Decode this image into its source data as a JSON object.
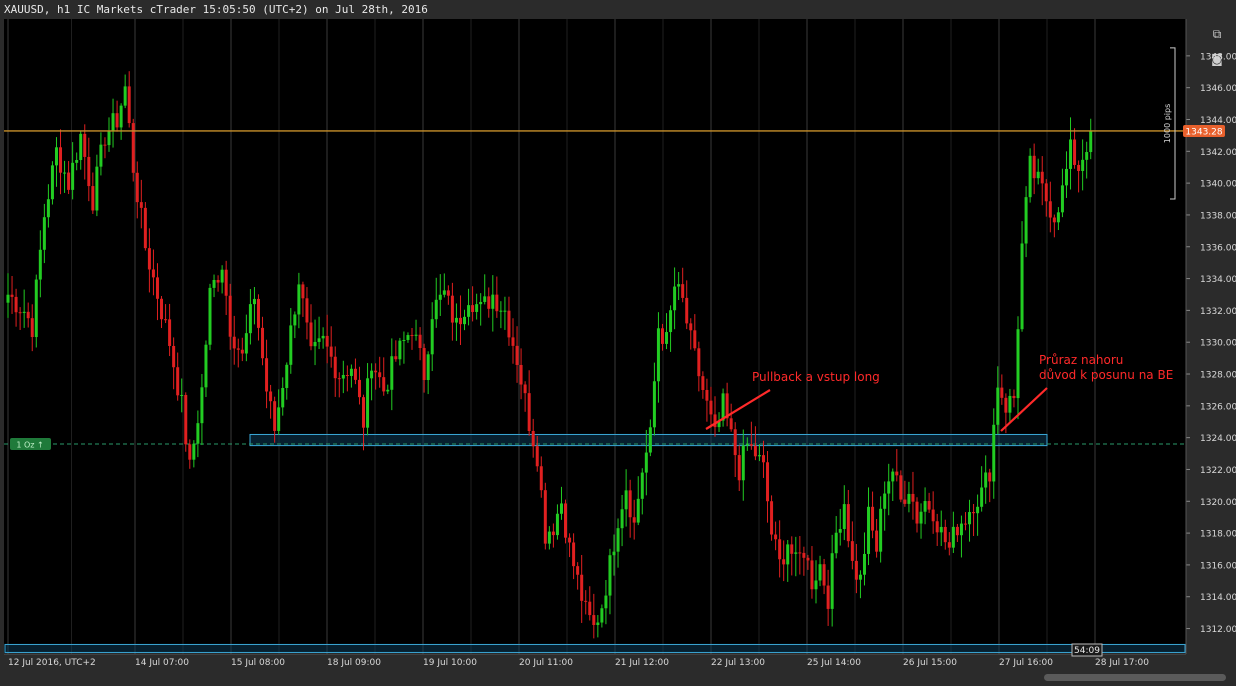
{
  "window": {
    "title": "XAUUSD, h1 IC Markets cTrader 15:05:50 (UTC+2) on Jul 28th, 2016",
    "toolbar_icons": [
      "popout-icon",
      "camera-icon"
    ]
  },
  "colors": {
    "background": "#000000",
    "frame": "#2b2b2b",
    "bull_candle": "#22cc22",
    "bear_candle": "#e02020",
    "price_line": "#c8902a",
    "price_tag": "#e8602c",
    "zone_fill": "#0d3b55",
    "zone_border": "#3aa8d8",
    "grid": "#2a2a2a",
    "annotation": "#ff2a2a",
    "position_tag": "#1f7a3a"
  },
  "chart_data": {
    "type": "candlestick",
    "symbol": "XAUUSD",
    "timeframe": "h1",
    "ylim": [
      1310.4,
      1349.5
    ],
    "y_ticks": [
      "1348.00",
      "1346.00",
      "1344.00",
      "1342.00",
      "1340.00",
      "1338.00",
      "1336.00",
      "1334.00",
      "1332.00",
      "1330.00",
      "1328.00",
      "1326.00",
      "1324.00",
      "1322.00",
      "1320.00",
      "1318.00",
      "1316.00",
      "1314.00",
      "1312.00"
    ],
    "x_ticks": [
      "12 Jul 2016, UTC+2",
      "14 Jul 07:00",
      "15 Jul 08:00",
      "18 Jul 09:00",
      "19 Jul 10:00",
      "20 Jul 11:00",
      "21 Jul 12:00",
      "22 Jul 13:00",
      "25 Jul 14:00",
      "26 Jul 15:00",
      "27 Jul 16:00",
      "28 Jul 17:00"
    ],
    "current_price": "1343.28",
    "current_price_value": 1343.28,
    "position_label": "1 Oz ↑",
    "position_price": 1323.6,
    "measure_label": "1000 pips",
    "countdown": "54:09",
    "zones": [
      {
        "from": 1323.5,
        "to": 1324.2
      },
      {
        "from": 1310.5,
        "to": 1311.0
      }
    ],
    "annotations": [
      "Pullback a vstup long",
      "Průraz nahoru",
      "důvod k posunu na BE"
    ],
    "key_prices": [
      {
        "i": 0,
        "p": 1333.0
      },
      {
        "i": 4,
        "p": 1332.0
      },
      {
        "i": 6,
        "p": 1331.0
      },
      {
        "i": 9,
        "p": 1338.0
      },
      {
        "i": 12,
        "p": 1342.0
      },
      {
        "i": 15,
        "p": 1340.0
      },
      {
        "i": 18,
        "p": 1343.0
      },
      {
        "i": 21,
        "p": 1339.0
      },
      {
        "i": 24,
        "p": 1343.0
      },
      {
        "i": 27,
        "p": 1344.0
      },
      {
        "i": 29,
        "p": 1346.0
      },
      {
        "i": 31,
        "p": 1341.0
      },
      {
        "i": 34,
        "p": 1336.0
      },
      {
        "i": 37,
        "p": 1333.0
      },
      {
        "i": 40,
        "p": 1330.0
      },
      {
        "i": 43,
        "p": 1326.0
      },
      {
        "i": 45,
        "p": 1322.0
      },
      {
        "i": 48,
        "p": 1327.0
      },
      {
        "i": 50,
        "p": 1333.0
      },
      {
        "i": 53,
        "p": 1335.0
      },
      {
        "i": 55,
        "p": 1331.0
      },
      {
        "i": 58,
        "p": 1329.0
      },
      {
        "i": 61,
        "p": 1333.0
      },
      {
        "i": 64,
        "p": 1327.0
      },
      {
        "i": 66,
        "p": 1324.5
      },
      {
        "i": 69,
        "p": 1329.0
      },
      {
        "i": 72,
        "p": 1334.0
      },
      {
        "i": 75,
        "p": 1329.0
      },
      {
        "i": 78,
        "p": 1330.0
      },
      {
        "i": 82,
        "p": 1328.0
      },
      {
        "i": 85,
        "p": 1328.5
      },
      {
        "i": 88,
        "p": 1325.0
      },
      {
        "i": 90,
        "p": 1329.0
      },
      {
        "i": 93,
        "p": 1327.0
      },
      {
        "i": 96,
        "p": 1329.0
      },
      {
        "i": 100,
        "p": 1331.0
      },
      {
        "i": 103,
        "p": 1328.0
      },
      {
        "i": 105,
        "p": 1332.0
      },
      {
        "i": 108,
        "p": 1333.0
      },
      {
        "i": 111,
        "p": 1331.0
      },
      {
        "i": 114,
        "p": 1333.0
      },
      {
        "i": 117,
        "p": 1332.0
      },
      {
        "i": 120,
        "p": 1333.0
      },
      {
        "i": 123,
        "p": 1332.0
      },
      {
        "i": 126,
        "p": 1329.0
      },
      {
        "i": 129,
        "p": 1325.0
      },
      {
        "i": 131,
        "p": 1323.0
      },
      {
        "i": 133,
        "p": 1318.0
      },
      {
        "i": 135,
        "p": 1318.5
      },
      {
        "i": 137,
        "p": 1320.0
      },
      {
        "i": 139,
        "p": 1317.0
      },
      {
        "i": 141,
        "p": 1315.0
      },
      {
        "i": 143,
        "p": 1313.0
      },
      {
        "i": 145,
        "p": 1312.0
      },
      {
        "i": 147,
        "p": 1313.5
      },
      {
        "i": 149,
        "p": 1316.0
      },
      {
        "i": 151,
        "p": 1319.0
      },
      {
        "i": 153,
        "p": 1321.0
      },
      {
        "i": 155,
        "p": 1318.5
      },
      {
        "i": 157,
        "p": 1322.0
      },
      {
        "i": 159,
        "p": 1324.0
      },
      {
        "i": 161,
        "p": 1331.0
      },
      {
        "i": 163,
        "p": 1330.0
      },
      {
        "i": 165,
        "p": 1333.5
      },
      {
        "i": 167,
        "p": 1332.5
      },
      {
        "i": 169,
        "p": 1330.0
      },
      {
        "i": 171,
        "p": 1328.0
      },
      {
        "i": 173,
        "p": 1326.0
      },
      {
        "i": 175,
        "p": 1324.0
      },
      {
        "i": 177,
        "p": 1326.0
      },
      {
        "i": 179,
        "p": 1324.0
      },
      {
        "i": 181,
        "p": 1322.0
      },
      {
        "i": 183,
        "p": 1323.5
      },
      {
        "i": 185,
        "p": 1323.0
      },
      {
        "i": 187,
        "p": 1322.0
      },
      {
        "i": 189,
        "p": 1318.0
      },
      {
        "i": 191,
        "p": 1316.0
      },
      {
        "i": 193,
        "p": 1317.5
      },
      {
        "i": 195,
        "p": 1316.0
      },
      {
        "i": 197,
        "p": 1317.0
      },
      {
        "i": 199,
        "p": 1315.0
      },
      {
        "i": 201,
        "p": 1316.0
      },
      {
        "i": 203,
        "p": 1314.0
      },
      {
        "i": 205,
        "p": 1318.0
      },
      {
        "i": 207,
        "p": 1320.0
      },
      {
        "i": 209,
        "p": 1316.0
      },
      {
        "i": 211,
        "p": 1315.0
      },
      {
        "i": 213,
        "p": 1319.0
      },
      {
        "i": 215,
        "p": 1317.0
      },
      {
        "i": 217,
        "p": 1321.0
      },
      {
        "i": 219,
        "p": 1322.0
      },
      {
        "i": 221,
        "p": 1320.0
      },
      {
        "i": 223,
        "p": 1321.0
      },
      {
        "i": 225,
        "p": 1319.0
      },
      {
        "i": 227,
        "p": 1320.0
      },
      {
        "i": 229,
        "p": 1319.5
      },
      {
        "i": 231,
        "p": 1318.0
      },
      {
        "i": 233,
        "p": 1317.0
      },
      {
        "i": 235,
        "p": 1318.5
      },
      {
        "i": 237,
        "p": 1319.0
      },
      {
        "i": 239,
        "p": 1320.0
      },
      {
        "i": 241,
        "p": 1320.5
      },
      {
        "i": 243,
        "p": 1322.0
      },
      {
        "i": 245,
        "p": 1327.5
      },
      {
        "i": 247,
        "p": 1326.0
      },
      {
        "i": 249,
        "p": 1326.5
      },
      {
        "i": 251,
        "p": 1336.0
      },
      {
        "i": 253,
        "p": 1341.0
      },
      {
        "i": 255,
        "p": 1340.0
      },
      {
        "i": 257,
        "p": 1339.0
      },
      {
        "i": 259,
        "p": 1338.0
      },
      {
        "i": 261,
        "p": 1339.5
      },
      {
        "i": 263,
        "p": 1342.0
      },
      {
        "i": 265,
        "p": 1341.0
      },
      {
        "i": 267,
        "p": 1342.5
      },
      {
        "i": 268,
        "p": 1343.3
      }
    ]
  }
}
